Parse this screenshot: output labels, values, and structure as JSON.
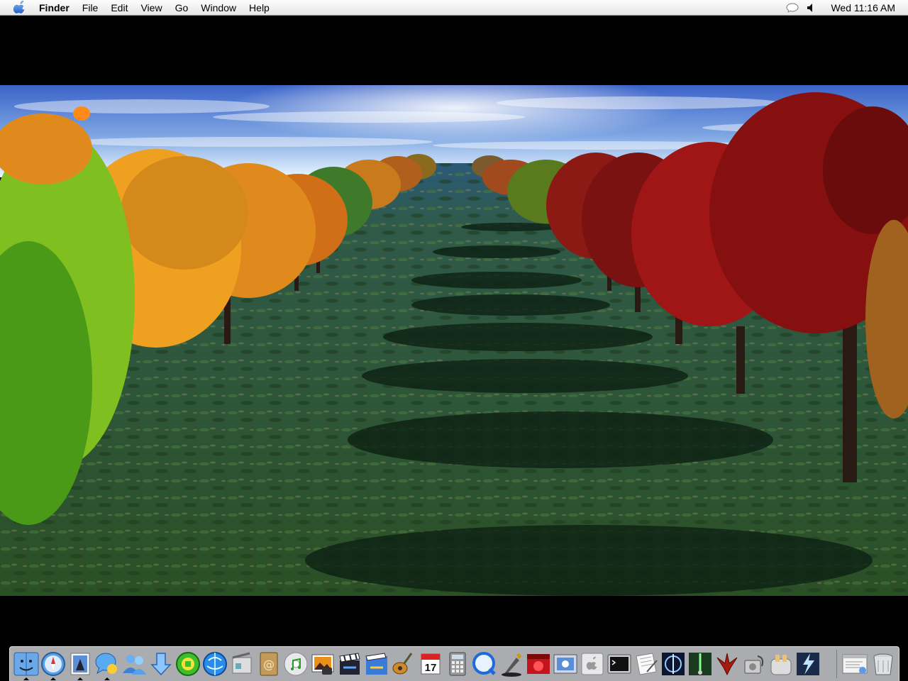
{
  "menubar": {
    "apple_icon": "apple-logo-icon",
    "app_name": "Finder",
    "items": [
      "File",
      "Edit",
      "View",
      "Go",
      "Window",
      "Help"
    ],
    "extras": {
      "speech_icon": "speech-bubble-icon",
      "volume_icon": "speaker-volume-icon"
    },
    "clock": "Wed 11:16 AM"
  },
  "desktop": {
    "wallpaper": "rendered orchard rows of autumn trees",
    "colors": {
      "sky_top": "#3a62c9",
      "sky_horizon": "#e8f4ff",
      "grass": "#2d5030",
      "left_foliage": "#e8921c",
      "right_foliage": "#a31a1a"
    }
  },
  "dock": {
    "items": [
      {
        "name": "finder-icon",
        "running": true
      },
      {
        "name": "safari-compass-icon",
        "running": true
      },
      {
        "name": "mail-stamp-icon",
        "running": true
      },
      {
        "name": "ichat-bubble-icon",
        "running": true
      },
      {
        "name": "address-book-people-icon",
        "running": false
      },
      {
        "name": "download-arrow-icon",
        "running": false
      },
      {
        "name": "green-circle-app-icon",
        "running": false
      },
      {
        "name": "blue-globe-icon",
        "running": false
      },
      {
        "name": "system-prefs-icon",
        "running": false
      },
      {
        "name": "address-book-icon",
        "running": false
      },
      {
        "name": "itunes-cd-icon",
        "running": false
      },
      {
        "name": "iphoto-icon",
        "running": false
      },
      {
        "name": "imovie-clapper-icon",
        "running": false
      },
      {
        "name": "idvd-icon",
        "running": false
      },
      {
        "name": "garageband-guitar-icon",
        "running": false
      },
      {
        "name": "ical-calendar-icon",
        "running": false
      },
      {
        "name": "calculator-icon",
        "running": false
      },
      {
        "name": "quicktime-icon",
        "running": false
      },
      {
        "name": "script-editor-icon",
        "running": false
      },
      {
        "name": "red-game-icon",
        "running": false
      },
      {
        "name": "preview-photos-icon",
        "running": false
      },
      {
        "name": "apple-app-icon",
        "running": false
      },
      {
        "name": "terminal-icon",
        "running": false
      },
      {
        "name": "text-edit-icon",
        "running": false
      },
      {
        "name": "jedi-game-icon",
        "running": false
      },
      {
        "name": "saber-game-icon",
        "running": false
      },
      {
        "name": "quake-icon",
        "running": false
      },
      {
        "name": "disk-utility-icon",
        "running": false
      },
      {
        "name": "toaster-icon",
        "running": false
      },
      {
        "name": "lightning-game-icon",
        "running": false
      },
      {
        "name": "minimized-window-icon",
        "running": false
      },
      {
        "name": "trash-icon",
        "running": false
      }
    ],
    "calendar_day": "17"
  }
}
